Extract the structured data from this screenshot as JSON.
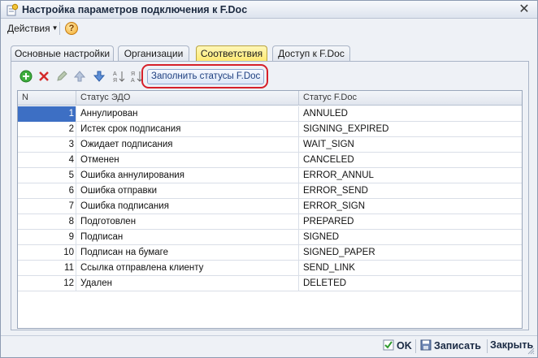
{
  "window": {
    "title": "Настройка параметров подключения к F.Doc"
  },
  "menu": {
    "actions_label": "Действия",
    "help_label": "?"
  },
  "tabs": [
    {
      "label": "Основные настройки",
      "active": false
    },
    {
      "label": "Организации",
      "active": false
    },
    {
      "label": "Соответствия",
      "active": true
    },
    {
      "label": "Доступ к F.Doc",
      "active": false
    }
  ],
  "toolbar": {
    "icons": [
      "add-icon",
      "delete-icon",
      "edit-icon",
      "move-up-icon",
      "move-down-icon",
      "sort-asc-icon",
      "sort-desc-icon"
    ],
    "fill_statuses_label": "Заполнить статусы F.Doc"
  },
  "table": {
    "headers": {
      "n": "N",
      "edo": "Статус ЭДО",
      "fdoc": "Статус F.Doc"
    },
    "rows": [
      {
        "n": "1",
        "edo": "Аннулирован",
        "fdoc": "ANNULED",
        "selected": true
      },
      {
        "n": "2",
        "edo": "Истек срок подписания",
        "fdoc": "SIGNING_EXPIRED"
      },
      {
        "n": "3",
        "edo": "Ожидает подписания",
        "fdoc": "WAIT_SIGN"
      },
      {
        "n": "4",
        "edo": "Отменен",
        "fdoc": "CANCELED"
      },
      {
        "n": "5",
        "edo": "Ошибка аннулирования",
        "fdoc": "ERROR_ANNUL"
      },
      {
        "n": "6",
        "edo": "Ошибка отправки",
        "fdoc": "ERROR_SEND"
      },
      {
        "n": "7",
        "edo": "Ошибка подписания",
        "fdoc": "ERROR_SIGN"
      },
      {
        "n": "8",
        "edo": "Подготовлен",
        "fdoc": "PREPARED"
      },
      {
        "n": "9",
        "edo": "Подписан",
        "fdoc": "SIGNED"
      },
      {
        "n": "10",
        "edo": "Подписан на бумаге",
        "fdoc": "SIGNED_PAPER"
      },
      {
        "n": "11",
        "edo": "Ссылка отправлена клиенту",
        "fdoc": "SEND_LINK"
      },
      {
        "n": "12",
        "edo": "Удален",
        "fdoc": "DELETED"
      }
    ]
  },
  "footer": {
    "ok_label": "OK",
    "save_label": "Записать",
    "close_label": "Закрыть"
  },
  "colors": {
    "accent_tab": "#ffe86a",
    "highlight": "#d6202a",
    "selection": "#3d6fc4"
  }
}
